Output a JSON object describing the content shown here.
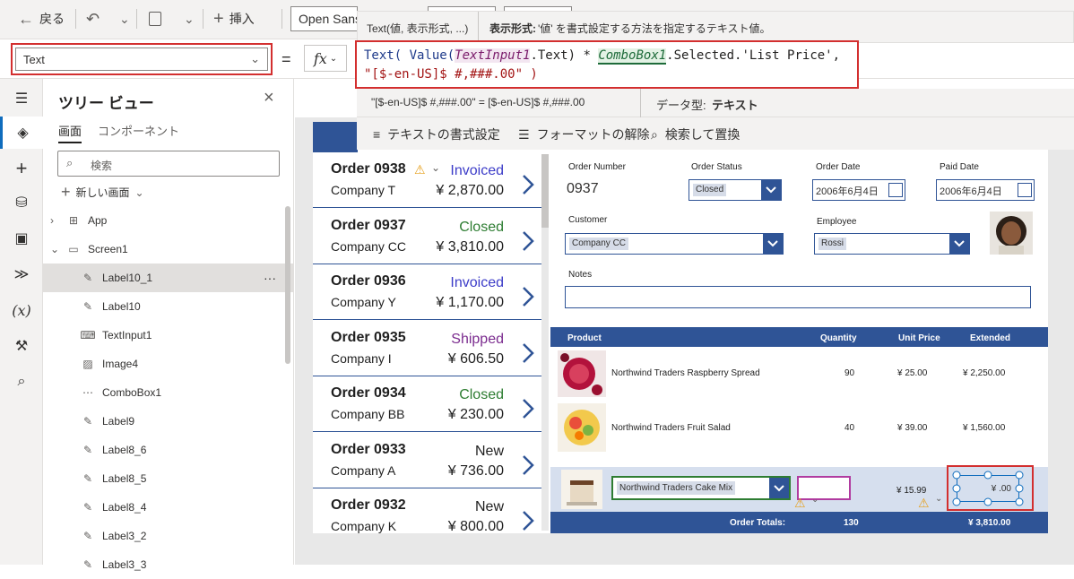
{
  "toolbar": {
    "back_label": "戻る",
    "insert_label": "挿入",
    "font_name": "Open Sans"
  },
  "tooltip": {
    "signature": "Text(値, 表示形式, ...)",
    "param_name": "表示形式:",
    "param_desc": "'値' を書式設定する方法を指定するテキスト値。"
  },
  "formula_bar": {
    "property": "Text",
    "equals": "=",
    "fx": "fx",
    "formula_tokens": [
      {
        "t": "Text( ",
        "c": "f-fn"
      },
      {
        "t": "Value(",
        "c": "f-fn"
      },
      {
        "t": "TextInput1",
        "c": "f-ctl"
      },
      {
        "t": ".Text) * ",
        "c": ""
      },
      {
        "t": "ComboBox1",
        "c": "f-cb"
      },
      {
        "t": ".Selected.'List Price',",
        "c": ""
      }
    ],
    "formula_line2": "\"[$-en-US]$ #,###.00\" )",
    "eval_expr": "\"[$-en-US]$ #,###.00\"  =  [$-en-US]$ #,###.00",
    "data_type_label": "データ型:",
    "data_type_value": "テキスト"
  },
  "format_bar": {
    "text_format": "テキストの書式設定",
    "remove_format": "フォーマットの解除",
    "find_replace": "検索して置換"
  },
  "tree_view": {
    "title": "ツリー ビュー",
    "tabs": [
      "画面",
      "コンポーネント"
    ],
    "search_placeholder": "検索",
    "new_screen": "新しい画面",
    "items": [
      {
        "label": "App",
        "icon": "app-icon",
        "indent": 0,
        "expand": "right"
      },
      {
        "label": "Screen1",
        "icon": "screen-icon",
        "indent": 0,
        "expand": "down"
      },
      {
        "label": "Label10_1",
        "icon": "label-icon",
        "indent": 1,
        "selected": true
      },
      {
        "label": "Label10",
        "icon": "label-icon",
        "indent": 1
      },
      {
        "label": "TextInput1",
        "icon": "textinput-icon",
        "indent": 1
      },
      {
        "label": "Image4",
        "icon": "image-icon",
        "indent": 1
      },
      {
        "label": "ComboBox1",
        "icon": "combobox-icon",
        "indent": 1
      },
      {
        "label": "Label9",
        "icon": "label-icon",
        "indent": 1
      },
      {
        "label": "Label8_6",
        "icon": "label-icon",
        "indent": 1
      },
      {
        "label": "Label8_5",
        "icon": "label-icon",
        "indent": 1
      },
      {
        "label": "Label8_4",
        "icon": "label-icon",
        "indent": 1
      },
      {
        "label": "Label3_2",
        "icon": "label-icon",
        "indent": 1
      },
      {
        "label": "Label3_3",
        "icon": "label-icon",
        "indent": 1
      }
    ],
    "more": "···"
  },
  "orders": [
    {
      "no": "Order 0938",
      "company": "Company T",
      "status": "Invoiced",
      "amount": "¥ 2,870.00",
      "color": "#3c3cc8",
      "warn": true
    },
    {
      "no": "Order 0937",
      "company": "Company CC",
      "status": "Closed",
      "amount": "¥ 3,810.00",
      "color": "#2e7d32"
    },
    {
      "no": "Order 0936",
      "company": "Company Y",
      "status": "Invoiced",
      "amount": "¥ 1,170.00",
      "color": "#3c3cc8"
    },
    {
      "no": "Order 0935",
      "company": "Company I",
      "status": "Shipped",
      "amount": "¥ 606.50",
      "color": "#7b2c8f"
    },
    {
      "no": "Order 0934",
      "company": "Company BB",
      "status": "Closed",
      "amount": "¥ 230.00",
      "color": "#2e7d32"
    },
    {
      "no": "Order 0933",
      "company": "Company A",
      "status": "New",
      "amount": "¥ 736.00",
      "color": "#1f1f1f"
    },
    {
      "no": "Order 0932",
      "company": "Company K",
      "status": "New",
      "amount": "¥ 800.00",
      "color": "#1f1f1f"
    }
  ],
  "detail": {
    "order_number_label": "Order Number",
    "order_number": "0937",
    "order_status_label": "Order Status",
    "order_status": "Closed",
    "order_date_label": "Order Date",
    "order_date": "2006年6月4日",
    "paid_date_label": "Paid Date",
    "paid_date": "2006年6月4日",
    "customer_label": "Customer",
    "customer": "Company CC",
    "employee_label": "Employee",
    "employee": "Rossi",
    "notes_label": "Notes"
  },
  "products": {
    "headers": [
      "Product",
      "Quantity",
      "Unit Price",
      "Extended"
    ],
    "rows": [
      {
        "name": "Northwind Traders Raspberry Spread",
        "qty": "90",
        "price": "¥ 25.00",
        "ext": "¥ 2,250.00"
      },
      {
        "name": "Northwind Traders Fruit Salad",
        "qty": "40",
        "price": "¥ 39.00",
        "ext": "¥ 1,560.00"
      }
    ],
    "new_row": {
      "combo": "Northwind Traders Cake Mix",
      "price": "¥ 15.99",
      "ext": "¥ .00"
    },
    "totals_label": "Order Totals:",
    "totals_qty": "130",
    "totals_ext": "¥ 3,810.00"
  }
}
